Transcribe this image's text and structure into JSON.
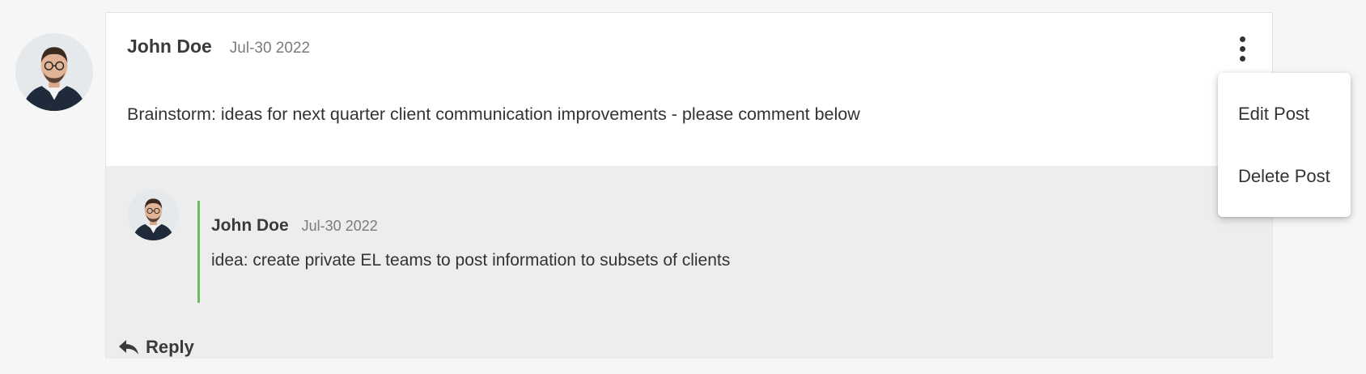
{
  "post": {
    "author": "John Doe",
    "date": "Jul-30 2022",
    "body": "Brainstorm: ideas for next quarter client communication improvements - please comment below"
  },
  "reply_item": {
    "author": "John Doe",
    "date": "Jul-30 2022",
    "text": "idea: create private EL teams to post information to subsets of clients"
  },
  "actions": {
    "reply_label": "Reply",
    "more_icon": "vertical-ellipsis-icon",
    "reply_icon": "reply-arrow-icon"
  },
  "menu": {
    "items": [
      "Edit Post",
      "Delete Post"
    ]
  },
  "colors": {
    "thread_accent": "#6abf5d",
    "comments_bg": "#ededed",
    "card_bg": "#ffffff",
    "page_bg": "#f6f6f6"
  }
}
